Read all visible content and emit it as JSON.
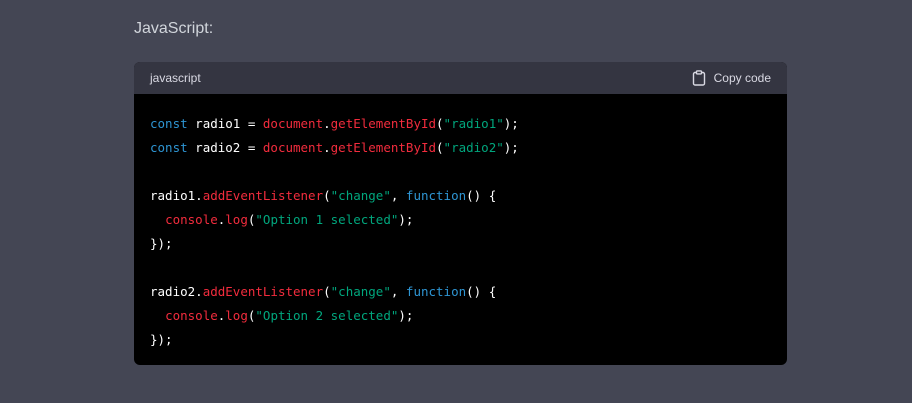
{
  "heading": "JavaScript:",
  "code_block": {
    "language": "javascript",
    "copy_label": "Copy code",
    "copy_icon": "clipboard-icon",
    "colors": {
      "keyword": "#2e95d3",
      "function": "#f22c3d",
      "string": "#00a67d",
      "plain": "#ffffff"
    },
    "lines": [
      [
        {
          "t": "kw",
          "s": "const"
        },
        {
          "t": "pl",
          "s": " radio1 = "
        },
        {
          "t": "obj",
          "s": "document"
        },
        {
          "t": "pl",
          "s": "."
        },
        {
          "t": "fn",
          "s": "getElementById"
        },
        {
          "t": "pl",
          "s": "("
        },
        {
          "t": "str",
          "s": "\"radio1\""
        },
        {
          "t": "pl",
          "s": ");"
        }
      ],
      [
        {
          "t": "kw",
          "s": "const"
        },
        {
          "t": "pl",
          "s": " radio2 = "
        },
        {
          "t": "obj",
          "s": "document"
        },
        {
          "t": "pl",
          "s": "."
        },
        {
          "t": "fn",
          "s": "getElementById"
        },
        {
          "t": "pl",
          "s": "("
        },
        {
          "t": "str",
          "s": "\"radio2\""
        },
        {
          "t": "pl",
          "s": ");"
        }
      ],
      [],
      [
        {
          "t": "pl",
          "s": "radio1."
        },
        {
          "t": "fn",
          "s": "addEventListener"
        },
        {
          "t": "pl",
          "s": "("
        },
        {
          "t": "str",
          "s": "\"change\""
        },
        {
          "t": "pl",
          "s": ", "
        },
        {
          "t": "kw",
          "s": "function"
        },
        {
          "t": "pl",
          "s": "() {"
        }
      ],
      [
        {
          "t": "pl",
          "s": "  "
        },
        {
          "t": "obj",
          "s": "console"
        },
        {
          "t": "pl",
          "s": "."
        },
        {
          "t": "fn",
          "s": "log"
        },
        {
          "t": "pl",
          "s": "("
        },
        {
          "t": "str",
          "s": "\"Option 1 selected\""
        },
        {
          "t": "pl",
          "s": ");"
        }
      ],
      [
        {
          "t": "pl",
          "s": "});"
        }
      ],
      [],
      [
        {
          "t": "pl",
          "s": "radio2."
        },
        {
          "t": "fn",
          "s": "addEventListener"
        },
        {
          "t": "pl",
          "s": "("
        },
        {
          "t": "str",
          "s": "\"change\""
        },
        {
          "t": "pl",
          "s": ", "
        },
        {
          "t": "kw",
          "s": "function"
        },
        {
          "t": "pl",
          "s": "() {"
        }
      ],
      [
        {
          "t": "pl",
          "s": "  "
        },
        {
          "t": "obj",
          "s": "console"
        },
        {
          "t": "pl",
          "s": "."
        },
        {
          "t": "fn",
          "s": "log"
        },
        {
          "t": "pl",
          "s": "("
        },
        {
          "t": "str",
          "s": "\"Option 2 selected\""
        },
        {
          "t": "pl",
          "s": ");"
        }
      ],
      [
        {
          "t": "pl",
          "s": "});"
        }
      ]
    ]
  }
}
